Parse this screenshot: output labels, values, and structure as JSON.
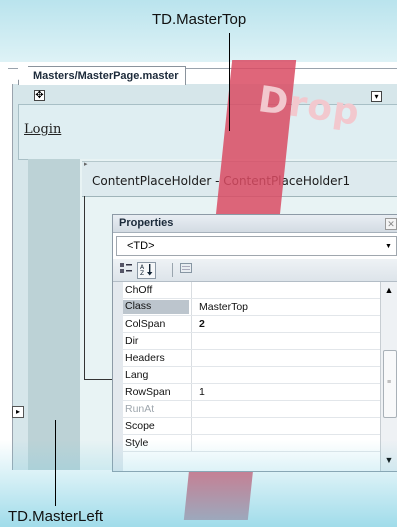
{
  "callouts": {
    "top_label": "TD.MasterTop",
    "bottom_label": "TD.MasterLeft"
  },
  "editor": {
    "tab_label": "Masters/MasterPage.master",
    "move_handle_glyph": "✥",
    "smart_tag_glyph": "▾",
    "login_link": "Login",
    "placeholder_title": "ContentPlaceHolder - ContentPlaceHolder1",
    "expand_glyph": "▸"
  },
  "watermark": {
    "text": "Drop"
  },
  "properties": {
    "title": "Properties",
    "close_glyph": "✕",
    "object_select": "<TD>",
    "dropdown_glyph": "▼",
    "toolbar": {
      "categorized_icon": "categorized-icon",
      "alphabetical_icon": "alphabetical-icon",
      "property_pages_icon": "property-pages-icon"
    },
    "rows": [
      {
        "name": "ChOff",
        "value": "",
        "bold": false,
        "dim": false,
        "selected": false
      },
      {
        "name": "Class",
        "value": "MasterTop",
        "bold": false,
        "dim": false,
        "selected": true
      },
      {
        "name": "ColSpan",
        "value": "2",
        "bold": true,
        "dim": false,
        "selected": false
      },
      {
        "name": "Dir",
        "value": "",
        "bold": false,
        "dim": false,
        "selected": false
      },
      {
        "name": "Headers",
        "value": "",
        "bold": false,
        "dim": false,
        "selected": false
      },
      {
        "name": "Lang",
        "value": "",
        "bold": false,
        "dim": false,
        "selected": false
      },
      {
        "name": "RowSpan",
        "value": "1",
        "bold": false,
        "dim": false,
        "selected": false
      },
      {
        "name": "RunAt",
        "value": "",
        "bold": false,
        "dim": true,
        "selected": false
      },
      {
        "name": "Scope",
        "value": "",
        "bold": false,
        "dim": false,
        "selected": false
      },
      {
        "name": "Style",
        "value": "",
        "bold": false,
        "dim": false,
        "selected": false
      }
    ],
    "scroll_up_glyph": "▲",
    "scroll_down_glyph": "▼"
  },
  "colors": {
    "watermark_red": "#d94b63",
    "watermark_cyan": "#78cde1",
    "design_surface": "#d6e6ea",
    "left_column": "#bcd2d6",
    "selected_row": "#bcc5cd"
  }
}
